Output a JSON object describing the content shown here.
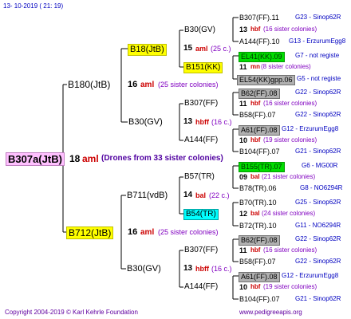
{
  "header": {
    "timestamp": "13- 10-2019 ( 21: 19)"
  },
  "footer": {
    "copyright": "Copyright 2004-2019 © Karl Kehrle Foundation",
    "site": "www.pedigreeapis.org"
  },
  "colors": {
    "line": "#000000",
    "code_blue": "#0000c0",
    "note_purple": "#8000c0",
    "mating_red": "#cc0000"
  },
  "root": {
    "name": "B307a(JtB)",
    "mating": "18",
    "mating_label": "aml",
    "note": "(Drones from 33 sister colonies)"
  },
  "gen1": [
    {
      "name": "B180(JtB)",
      "mating": "16",
      "mating_label": "aml",
      "note": "(25 sister colonies)"
    },
    {
      "name": "B712(JtB)",
      "mating": "16",
      "mating_label": "aml",
      "note": "(25 sister colonies)"
    }
  ],
  "gen2": [
    {
      "name": "B18(JtB)",
      "mating": "15",
      "mating_label": "aml",
      "note": "(25 c.)"
    },
    {
      "name": "B30(GV)",
      "mating": "13",
      "mating_label": "hbff",
      "note": "(16 c.)"
    },
    {
      "name": "B711(vdB)",
      "mating": "14",
      "mating_label": "bal",
      "note": "(22 c.)"
    },
    {
      "name": "B30(GV)",
      "mating": "13",
      "mating_label": "hbff",
      "note": "(16 c.)"
    }
  ],
  "gen3": [
    "B30(GV)",
    "B151(KK)",
    "B307(FF)",
    "A144(FF)",
    "B57(TR)",
    "B54(TR)",
    "B307(FF)",
    "A144(FF)"
  ],
  "gen4": [
    {
      "l1": "B307(FF).11",
      "c1": "G23 - Sinop62R",
      "mn": "13",
      "ml": "hbf",
      "n": "(16 sister colonies)",
      "l2": "A144(FF).10",
      "c2": "G13 - ErzurumEgg8"
    },
    {
      "l1": "EL41(KK).09",
      "c1": "G7 - not registe",
      "mn": "11",
      "ml": "mn",
      "n": "(8 sister colonies)",
      "l2": "EL54(KK)gpp.06",
      "c2": "G5 - not registe"
    },
    {
      "l1": "B62(FF).08",
      "c1": "G22 - Sinop62R",
      "mn": "11",
      "ml": "hbf",
      "n": "(16 sister colonies)",
      "l2": "B58(FF).07",
      "c2": "G22 - Sinop62R"
    },
    {
      "l1": "A61(FF).08",
      "c1": "G12 - ErzurumEgg8",
      "mn": "10",
      "ml": "hbf",
      "n": "(19 sister colonies)",
      "l2": "B104(FF).07",
      "c2": "G21 - Sinop62R"
    },
    {
      "l1": "B155(TR).07",
      "c1": "G6 - MG00R",
      "mn": "09",
      "ml": "bal",
      "n": "(21 sister colonies)",
      "l2": "B78(TR).06",
      "c2": "G8 - NO6294R"
    },
    {
      "l1": "B70(TR).10",
      "c1": "G25 - Sinop62R",
      "mn": "12",
      "ml": "bal",
      "n": "(24 sister colonies)",
      "l2": "B72(TR).10",
      "c2": "G11 - NO6294R"
    },
    {
      "l1": "B62(FF).08",
      "c1": "G22 - Sinop62R",
      "mn": "11",
      "ml": "hbf",
      "n": "(16 sister colonies)",
      "l2": "B58(FF).07",
      "c2": "G22 - Sinop62R"
    },
    {
      "l1": "A61(FF).08",
      "c1": "G12 - ErzurumEgg8",
      "mn": "10",
      "ml": "hbf",
      "n": "(19 sister colonies)",
      "l2": "B104(FF).07",
      "c2": "G21 - Sinop62R"
    }
  ]
}
